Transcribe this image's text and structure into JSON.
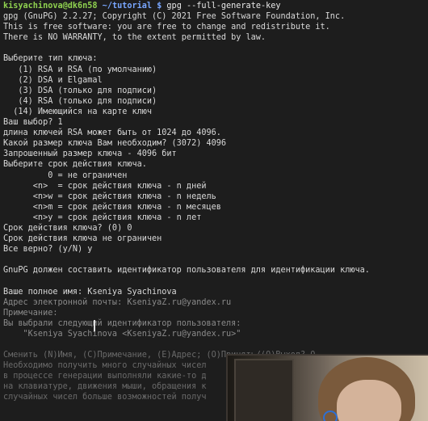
{
  "prompt": {
    "user_host": "kisyachinova@dk6n58",
    "path": " ~/tutorial $ ",
    "command": "gpg --full-generate-key"
  },
  "lines": [
    "gpg (GnuPG) 2.2.27; Copyright (C) 2021 Free Software Foundation, Inc.",
    "This is free software: you are free to change and redistribute it.",
    "There is NO WARRANTY, to the extent permitted by law.",
    "",
    "Выберите тип ключа:",
    "   (1) RSA и RSA (по умолчанию)",
    "   (2) DSA и Elgamal",
    "   (3) DSA (только для подписи)",
    "   (4) RSA (только для подписи)",
    "  (14) Имеющийся на карте ключ",
    "Ваш выбор? 1",
    "длина ключей RSA может быть от 1024 до 4096.",
    "Какой размер ключа Вам необходим? (3072) 4096",
    "Запрошенный размер ключа - 4096 бит",
    "Выберите срок действия ключа.",
    "         0 = не ограничен",
    "      <n>  = срок действия ключа - n дней",
    "      <n>w = срок действия ключа - n недель",
    "      <n>m = срок действия ключа - n месяцев",
    "      <n>y = срок действия ключа - n лет",
    "Срок действия ключа? (0) 0",
    "Срок действия ключа не ограничен",
    "Все верно? (y/N) y",
    "",
    "GnuPG должен составить идентификатор пользователя для идентификации ключа.",
    "",
    "Ваше полное имя: Kseniya Syachinova",
    "Адрес электронной почты: KseniyaZ.ru@yandex.ru",
    "Примечание:",
    "Вы выбрали следующий идентификатор пользователя:",
    "    \"Kseniya Syachinova <KseniyaZ.ru@yandex.ru>\"",
    "",
    "Сменить (N)Имя, (C)Примечание, (E)Адрес; (O)Принять/(Q)Выход? O",
    "Необходимо получить много случайных чисел",
    "в процессе генерации выполняли какие-то д",
    "на клавиатуре, движения мыши, обращения к",
    "случайных чисел больше возможностей получ"
  ],
  "colors": {
    "background": "#1d1d1d",
    "text": "#d9d9d9",
    "prompt_user": "#8fd14f",
    "prompt_path": "#79a7ff"
  },
  "overlay": {
    "type": "webcam-video",
    "icon": "person-video-icon"
  }
}
